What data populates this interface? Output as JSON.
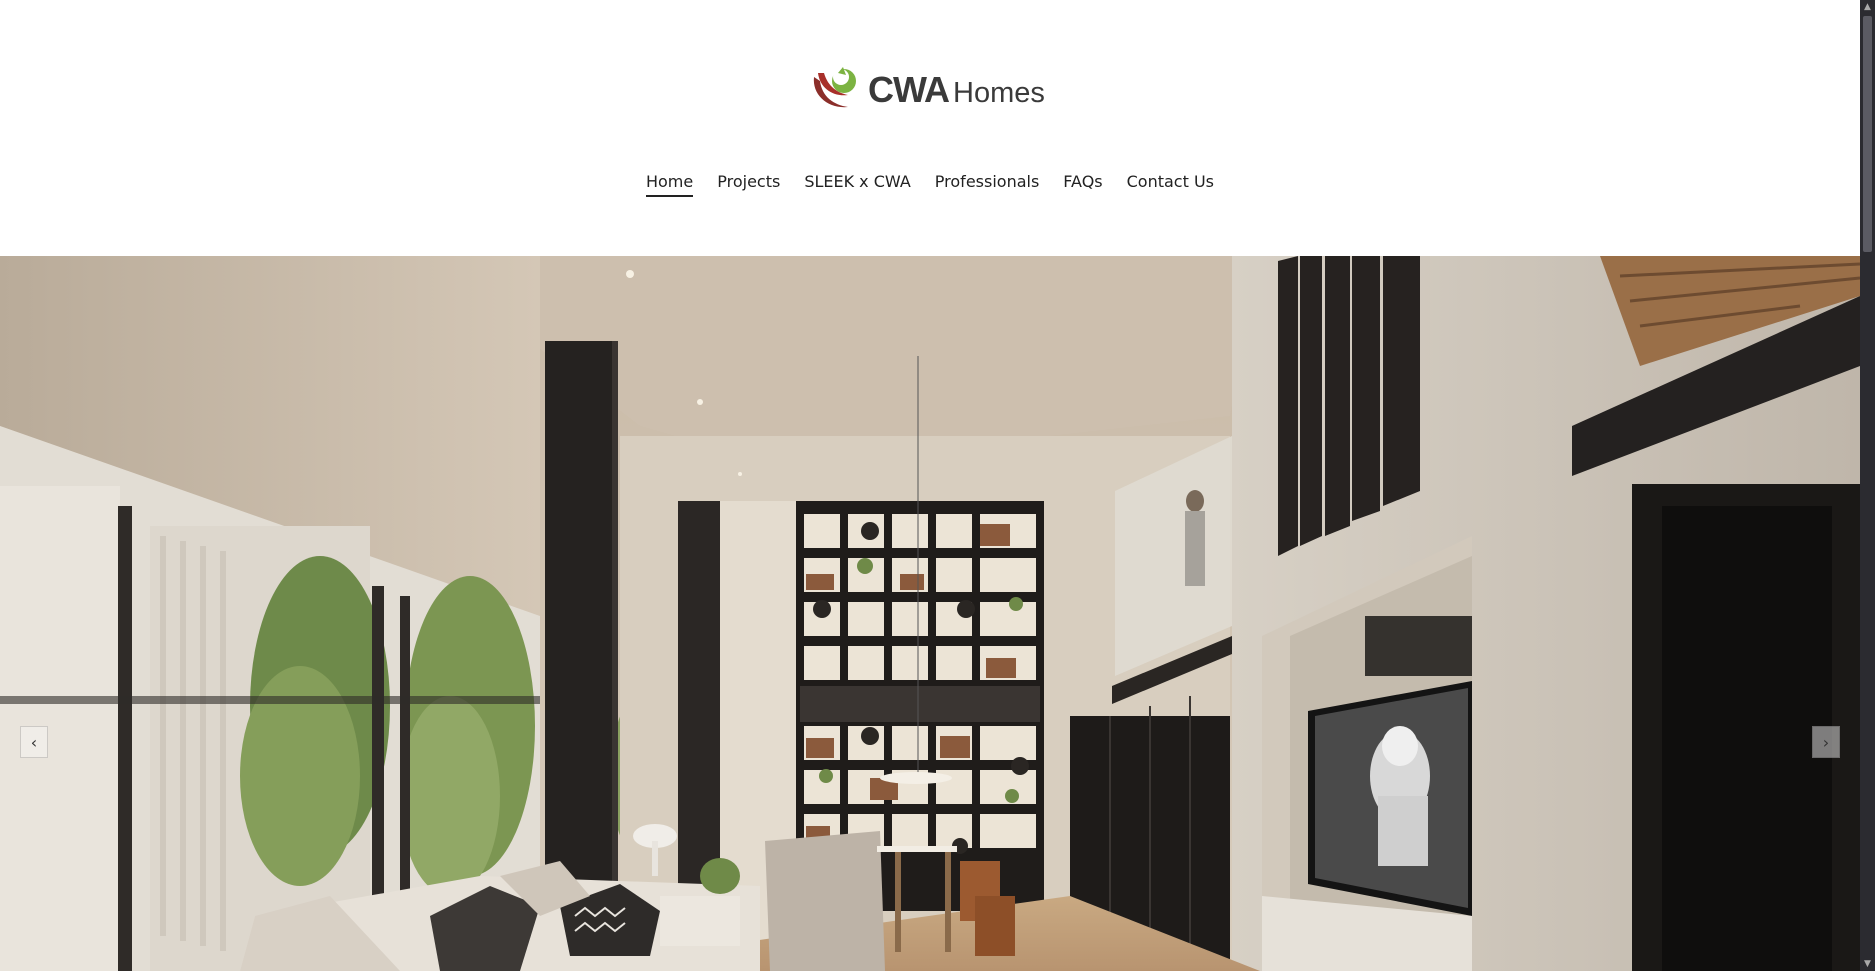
{
  "brand": {
    "name_primary": "CWA",
    "name_secondary": "Homes",
    "logo_colors": {
      "green": "#7cb342",
      "red": "#8b2e2a"
    }
  },
  "nav": {
    "items": [
      {
        "label": "Home",
        "active": true
      },
      {
        "label": "Projects",
        "active": false
      },
      {
        "label": "SLEEK x CWA",
        "active": false
      },
      {
        "label": "Professionals",
        "active": false
      },
      {
        "label": "FAQs",
        "active": false
      },
      {
        "label": "Contact Us",
        "active": false
      }
    ]
  },
  "hero": {
    "prev_icon": "‹",
    "next_icon": "›",
    "image_subject": "modern double-height living room interior render"
  },
  "scrollbar": {
    "up_icon": "▲",
    "down_icon": "▼"
  }
}
